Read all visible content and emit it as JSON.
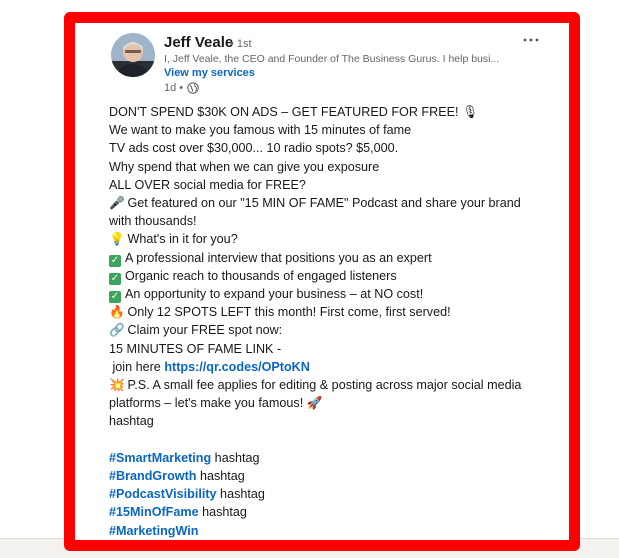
{
  "author": {
    "name": "Jeff Veale",
    "degree": "• 1st",
    "headline": "I, Jeff Veale, the CEO and Founder of The Business Gurus. I help busi...",
    "services_link": "View my services",
    "time": "1d •"
  },
  "icons": {
    "more": "more-options-icon",
    "visibility": "globe-icon"
  },
  "post": {
    "line1_text": "DON'T SPEND $30K ON ADS – GET FEATURED FOR FREE! ",
    "line1_emoji": "🎙",
    "line2": "We want to make you famous with 15 minutes of fame",
    "line3": "TV ads cost over $30,000... 10 radio spots? $5,000.",
    "line4": "Why spend that when we can give you exposure",
    "line5": "ALL OVER social media for FREE?",
    "line6_emoji": "🎤",
    "line6_text": "Get featured on our \"15 MIN OF FAME\" Podcast and share your brand with thousands!",
    "line7_emoji": "💡",
    "line7_text": "What's in it for you?",
    "check1": "A professional interview that positions you as an expert",
    "check2": "Organic reach to thousands of engaged listeners",
    "check3": "An opportunity to expand your business – at NO cost!",
    "fire_emoji": "🔥",
    "fire_text": "Only 12 SPOTS LEFT this month! First come, first served!",
    "link_emoji": "🔗",
    "link_text": "Claim your FREE spot now:",
    "fame_link_label": "15 MINUTES OF FAME LINK -",
    "join_here": " join here ",
    "join_url": "https://qr.codes/OPtoKN",
    "ps_emoji": "💥",
    "ps_text": "P.S. A small fee applies for editing & posting across major social media platforms – let's make you famous! ",
    "rocket_emoji": "🚀",
    "hashtag_word": "hashtag",
    "hashtags": [
      {
        "tag": "#SmartMarketing",
        "suffix": " hashtag"
      },
      {
        "tag": "#BrandGrowth",
        "suffix": " hashtag"
      },
      {
        "tag": "#PodcastVisibility",
        "suffix": " hashtag"
      },
      {
        "tag": "#15MinOfFame",
        "suffix": " hashtag"
      },
      {
        "tag": "#MarketingWin",
        "suffix": ""
      }
    ]
  },
  "colors": {
    "highlight": "#ff0000",
    "link": "#0a66c2",
    "check": "#3ba55d"
  }
}
